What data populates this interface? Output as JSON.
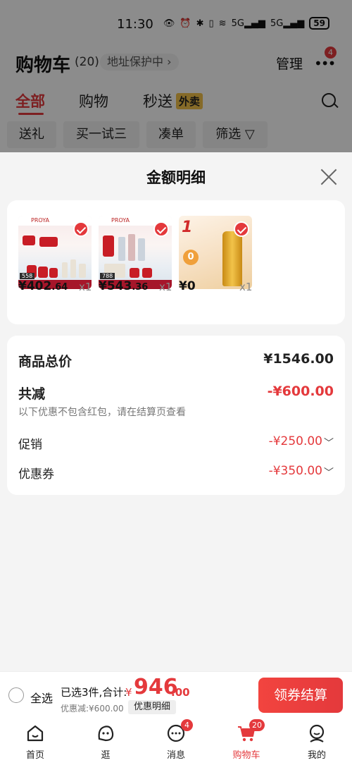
{
  "status_bar": {
    "time": "11:30",
    "signal_1": "5G",
    "signal_2": "5G",
    "battery": "59"
  },
  "header": {
    "title": "购物车",
    "count": "(20)",
    "address_protect": "地址保护中 ›",
    "manage": "管理",
    "more_badge": "4"
  },
  "tabs": [
    {
      "label": "全部",
      "active": true
    },
    {
      "label": "购物",
      "active": false
    },
    {
      "label": "秒送",
      "active": false
    }
  ],
  "takeout_tag": "外卖",
  "filters": [
    "送礼",
    "买一试三",
    "凑单",
    "筛选 ▽"
  ],
  "sheet": {
    "title": "金额明细",
    "products": [
      {
        "brand": "PROYA",
        "price_main": "¥402",
        "price_decimal": ".64",
        "qty": "x1",
        "number": "558",
        "selected": true
      },
      {
        "brand": "PROYA",
        "price_main": "¥543",
        "price_decimal": ".36",
        "qty": "x1",
        "number": "788",
        "selected": true
      },
      {
        "big_text": "1",
        "price_main": "¥0",
        "price_decimal": "",
        "qty": "x1",
        "circle": "0",
        "selected": true
      }
    ],
    "summary": {
      "total_label": "商品总价",
      "total_value": "¥1546.00",
      "reduce_label": "共减",
      "reduce_value": "-¥600.00",
      "reduce_note": "以下优惠不包含红包，请在结算页查看",
      "promo_label": "促销",
      "promo_value": "-¥250.00",
      "coupon_label": "优惠券",
      "coupon_value": "-¥350.00"
    }
  },
  "bottom_bar": {
    "select_all": "全选",
    "selected_info": "已选3件,合计:",
    "currency": "¥",
    "total_int": "946",
    "total_dec": ".00",
    "discount_text": "优惠减:¥600.00",
    "detail_button": "优惠明细",
    "checkout_button": "领券结算"
  },
  "nav": [
    {
      "label": "首页",
      "icon": "home-icon"
    },
    {
      "label": "逛",
      "icon": "browse-icon"
    },
    {
      "label": "消息",
      "icon": "message-icon",
      "badge": "4"
    },
    {
      "label": "购物车",
      "icon": "cart-icon",
      "badge": "20",
      "active": true
    },
    {
      "label": "我的",
      "icon": "profile-icon"
    }
  ],
  "colors": {
    "accent": "#e4393c",
    "background": "#f4f4f4"
  }
}
